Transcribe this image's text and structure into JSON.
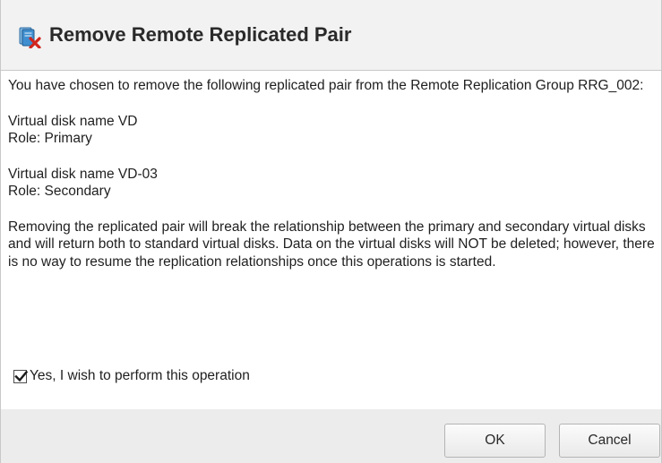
{
  "dialog": {
    "title": "Remove Remote Replicated Pair",
    "icon": "remove-pair-icon"
  },
  "message": {
    "intro": "You have chosen to remove the following replicated pair from the Remote Replication Group RRG_002:",
    "disks": [
      {
        "name": "Virtual disk name VD",
        "role": "Role: Primary"
      },
      {
        "name": "Virtual disk name VD-03",
        "role": "Role: Secondary"
      }
    ],
    "warning": "Removing the replicated pair will break the relationship between the primary and secondary virtual disks and will return both to standard virtual disks. Data on the virtual disks will NOT be deleted; however, there is no way to resume the replication relationships once this operations is started."
  },
  "confirm": {
    "label": "Yes, I wish to perform this operation",
    "checked": true
  },
  "buttons": {
    "ok": "OK",
    "cancel": "Cancel"
  },
  "colors": {
    "header_bg": "#f2f2f2",
    "footer_bg": "#ececec",
    "icon_blue": "#2f7fbf",
    "icon_red": "#d0261d"
  }
}
